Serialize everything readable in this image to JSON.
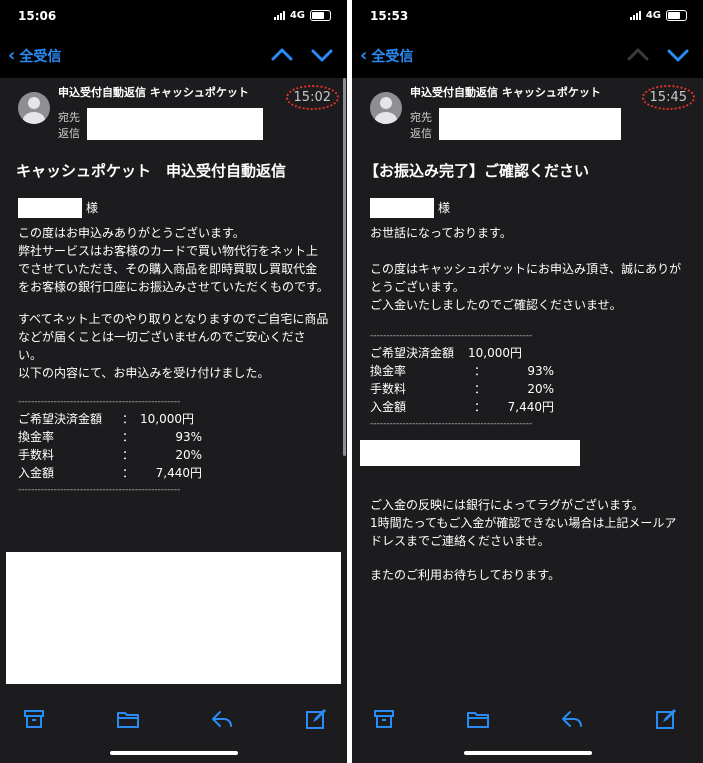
{
  "left": {
    "status_time": "15:06",
    "network": "4G",
    "back_label": "全受信",
    "sender": "申込受付自動返信 キャッシュポケット",
    "to_label": "宛先",
    "reply_label": "返信",
    "received_time": "15:02",
    "subject": "キャッシュポケット　申込受付自動返信",
    "salutation": "様",
    "paragraphs": [
      "この度はお申込みありがとうございます。\n弊社サービスはお客様のカードで買い物代行をネット上でさせていただき、その購入商品を即時買取し買取代金をお客様の銀行口座にお振込みさせていただくものです。",
      "すべてネット上でのやり取りとなりますのでご自宅に商品などが届くことは一切ございませんのでご安心ください。\n以下の内容にて、お申込みを受け付けました。"
    ],
    "separator": "--------------------------------------------------",
    "details": [
      {
        "key": "ご希望決済金額",
        "colon": "：",
        "value": "10,000円"
      },
      {
        "key": "換金率",
        "colon": "：",
        "value": "93%"
      },
      {
        "key": "手数料",
        "colon": "：",
        "value": "20%"
      },
      {
        "key": "入金額",
        "colon": "：",
        "value": "7,440円"
      }
    ]
  },
  "right": {
    "status_time": "15:53",
    "network": "4G",
    "back_label": "全受信",
    "sender": "申込受付自動返信 キャッシュポケット",
    "to_label": "宛先",
    "reply_label": "返信",
    "received_time": "15:45",
    "subject": "【お振込み完了】ご確認ください",
    "salutation": "様",
    "greeting": "お世話になっております。",
    "body1": "この度はキャッシュポケットにお申込み頂き、誠にありがとうございます。\nご入金いたしましたのでご確認くださいませ。",
    "separator": "--------------------------------------------------",
    "details": [
      {
        "key": "ご希望決済金額",
        "colon": "：",
        "value": "10,000円"
      },
      {
        "key": "換金率",
        "colon": "：",
        "value": "93%"
      },
      {
        "key": "手数料",
        "colon": "：",
        "value": "20%"
      },
      {
        "key": "入金額",
        "colon": "：",
        "value": "7,440円"
      }
    ],
    "body2": "ご入金の反映には銀行によってラグがございます。\n1時間たってもご入金が確認できない場合は上記メールアドレスまでご連絡くださいませ。",
    "closing": "またのご利用お待ちしております。"
  },
  "icons": [
    "archive-icon",
    "folder-icon",
    "reply-icon",
    "compose-icon"
  ],
  "colors": {
    "accent": "#2a8bf5",
    "background": "#1c1c1e",
    "highlight": "#e0332a"
  }
}
